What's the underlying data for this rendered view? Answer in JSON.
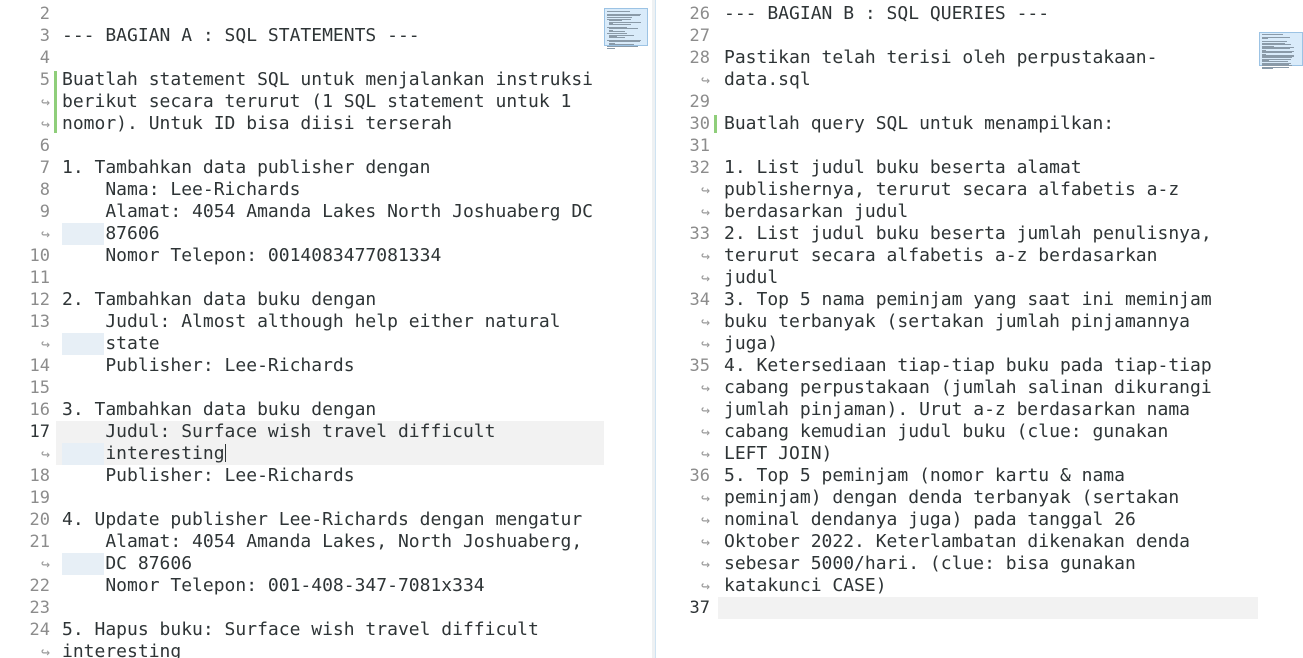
{
  "left_editor": {
    "lines": [
      {
        "n": "2",
        "text": ""
      },
      {
        "n": "3",
        "text": "--- BAGIAN A : SQL STATEMENTS ---"
      },
      {
        "n": "4",
        "text": ""
      },
      {
        "n": "5",
        "text": "Buatlah statement SQL untuk menjalankan instruksi"
      },
      {
        "n": "↪",
        "text": "berikut secara terurut (1 SQL statement untuk 1"
      },
      {
        "n": "↪",
        "text": "nomor). Untuk ID bisa diisi terserah"
      },
      {
        "n": "6",
        "text": ""
      },
      {
        "n": "7",
        "text": "1. Tambahkan data publisher dengan"
      },
      {
        "n": "8",
        "text": "    Nama: Lee-Richards"
      },
      {
        "n": "9",
        "text": "    Alamat: 4054 Amanda Lakes North Joshuaberg DC"
      },
      {
        "n": "↪",
        "text": "    87606"
      },
      {
        "n": "10",
        "text": "    Nomor Telepon: 0014083477081334"
      },
      {
        "n": "11",
        "text": ""
      },
      {
        "n": "12",
        "text": "2. Tambahkan data buku dengan"
      },
      {
        "n": "13",
        "text": "    Judul: Almost although help either natural"
      },
      {
        "n": "↪",
        "text": "    state"
      },
      {
        "n": "14",
        "text": "    Publisher: Lee-Richards"
      },
      {
        "n": "15",
        "text": ""
      },
      {
        "n": "16",
        "text": "3. Tambahkan data buku dengan"
      },
      {
        "n": "17",
        "text": "    Judul: Surface wish travel difficult"
      },
      {
        "n": "↪",
        "text": "    interesting"
      },
      {
        "n": "18",
        "text": "    Publisher: Lee-Richards"
      },
      {
        "n": "19",
        "text": ""
      },
      {
        "n": "20",
        "text": "4. Update publisher Lee-Richards dengan mengatur"
      },
      {
        "n": "21",
        "text": "    Alamat: 4054 Amanda Lakes, North Joshuaberg,"
      },
      {
        "n": "↪",
        "text": "    DC 87606"
      },
      {
        "n": "22",
        "text": "    Nomor Telepon: 001-408-347-7081x334"
      },
      {
        "n": "23",
        "text": ""
      },
      {
        "n": "24",
        "text": "5. Hapus buku: Surface wish travel difficult"
      },
      {
        "n": "↪",
        "text": "interesting"
      }
    ]
  },
  "right_editor": {
    "lines": [
      {
        "n": "26",
        "text": "--- BAGIAN B : SQL QUERIES ---"
      },
      {
        "n": "27",
        "text": ""
      },
      {
        "n": "28",
        "text": "Pastikan telah terisi oleh perpustakaan-"
      },
      {
        "n": "↪",
        "text": "data.sql"
      },
      {
        "n": "29",
        "text": ""
      },
      {
        "n": "30",
        "text": "Buatlah query SQL untuk menampilkan:"
      },
      {
        "n": "31",
        "text": ""
      },
      {
        "n": "32",
        "text": "1. List judul buku beserta alamat"
      },
      {
        "n": "↪",
        "text": "publishernya, terurut secara alfabetis a-z"
      },
      {
        "n": "↪",
        "text": "berdasarkan judul"
      },
      {
        "n": "33",
        "text": "2. List judul buku beserta jumlah penulisnya,"
      },
      {
        "n": "↪",
        "text": "terurut secara alfabetis a-z berdasarkan"
      },
      {
        "n": "↪",
        "text": "judul"
      },
      {
        "n": "34",
        "text": "3. Top 5 nama peminjam yang saat ini meminjam"
      },
      {
        "n": "↪",
        "text": "buku terbanyak (sertakan jumlah pinjamannya"
      },
      {
        "n": "↪",
        "text": "juga)"
      },
      {
        "n": "35",
        "text": "4. Ketersediaan tiap-tiap buku pada tiap-tiap"
      },
      {
        "n": "↪",
        "text": "cabang perpustakaan (jumlah salinan dikurangi"
      },
      {
        "n": "↪",
        "text": "jumlah pinjaman). Urut a-z berdasarkan nama"
      },
      {
        "n": "↪",
        "text": "cabang kemudian judul buku (clue: gunakan"
      },
      {
        "n": "↪",
        "text": "LEFT JOIN)"
      },
      {
        "n": "36",
        "text": "5. Top 5 peminjam (nomor kartu & nama"
      },
      {
        "n": "↪",
        "text": "peminjam) dengan denda terbanyak (sertakan"
      },
      {
        "n": "↪",
        "text": "nominal dendanya juga) pada tanggal 26"
      },
      {
        "n": "↪",
        "text": "Oktober 2022. Keterlambatan dikenakan denda"
      },
      {
        "n": "↪",
        "text": "sebesar 5000/hari. (clue: bisa gunakan"
      },
      {
        "n": "↪",
        "text": "katakunci CASE)"
      },
      {
        "n": "37",
        "text": ""
      }
    ]
  },
  "colors": {
    "line_number": "#8c8c8c",
    "current_line_bg": "#f2f2f2",
    "change_marker": "#8fce7a",
    "minimap_view": "#d9ebfa"
  }
}
